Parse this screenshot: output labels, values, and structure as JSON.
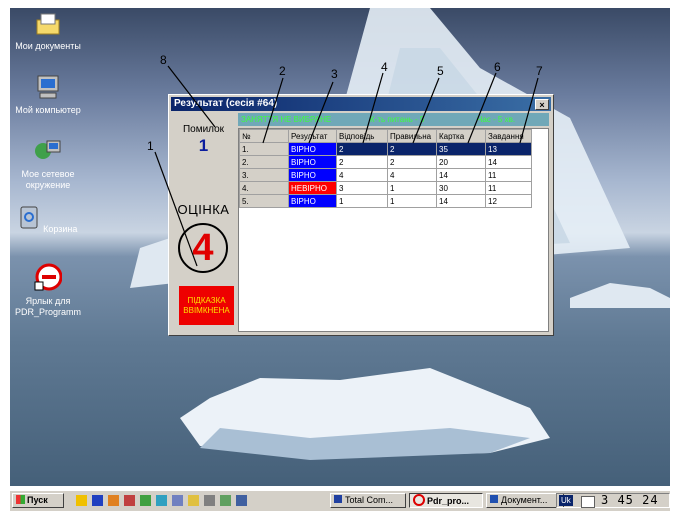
{
  "desktop": {
    "icons": [
      {
        "label": "Мои документы",
        "icon": "folder-icon"
      },
      {
        "label": "Мой компьютер",
        "icon": "computer-icon"
      },
      {
        "label": "Мое сетевое окружение",
        "icon": "network-icon"
      },
      {
        "label": "Корзина",
        "icon": "recycle-bin-icon"
      },
      {
        "label": "Ярлык для PDR_Programm",
        "icon": "no-entry-icon"
      }
    ]
  },
  "window": {
    "title": "Результат (сесія #64)",
    "close": "×",
    "pomilok_label": "Помилок",
    "pomilok_value": "1",
    "ocinka_label": "ОЦІНКА",
    "grade": "4",
    "hint_line1": "ПІДКАЗКА",
    "hint_line2": "ВВІМКНЕНА",
    "status_left": "ЗАНЯТТЯ НЕ ВИБРАНЕ",
    "status_mid": "К-ть питань - 5",
    "status_right": "Час - 5 хв.",
    "columns": [
      "№",
      "Результат",
      "Відповідь",
      "Правильна",
      "Картка",
      "Завдання"
    ],
    "rows": [
      {
        "n": "1.",
        "result": "ВІРНО",
        "answer": "2",
        "correct": "2",
        "card": "35",
        "task": "13"
      },
      {
        "n": "2.",
        "result": "ВІРНО",
        "answer": "2",
        "correct": "2",
        "card": "20",
        "task": "14"
      },
      {
        "n": "3.",
        "result": "ВІРНО",
        "answer": "4",
        "correct": "4",
        "card": "14",
        "task": "11"
      },
      {
        "n": "4.",
        "result": "НЕВІРНО",
        "answer": "3",
        "correct": "1",
        "card": "30",
        "task": "11"
      },
      {
        "n": "5.",
        "result": "ВІРНО",
        "answer": "1",
        "correct": "1",
        "card": "14",
        "task": "12"
      }
    ]
  },
  "annotations": [
    "1",
    "1",
    "2",
    "3",
    "4",
    "5",
    "6",
    "7",
    "8"
  ],
  "taskbar": {
    "start": "Пуск",
    "tasks": [
      "Total Com...",
      "Pdr_pro...",
      "Документ..."
    ],
    "lang": "Uk",
    "clock": "3 45 24"
  },
  "colors": {
    "ok": "#0000ff",
    "bad": "#ff0000",
    "title": "#0a246a",
    "hint": "#ee0000"
  }
}
